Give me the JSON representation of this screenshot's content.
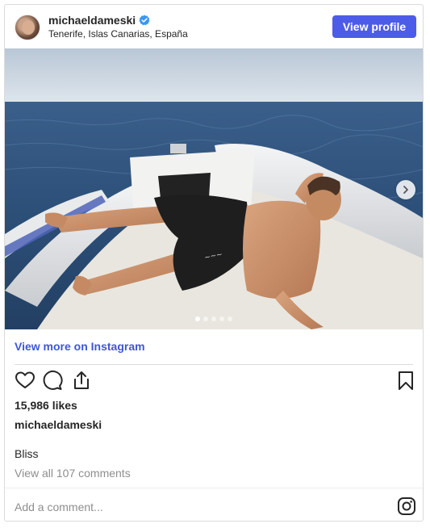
{
  "header": {
    "username": "michaeldameski",
    "verified_icon": "verified-badge-icon",
    "location": "Tenerife, Islas Canarias, España",
    "view_profile_label": "View profile"
  },
  "media": {
    "slide_count": 5,
    "active_slide": 1,
    "next_icon": "chevron-right-icon"
  },
  "links": {
    "view_more": "View more on Instagram"
  },
  "actions": {
    "icons": [
      "heart-icon",
      "comment-icon",
      "share-icon",
      "bookmark-icon"
    ]
  },
  "post": {
    "likes": "15,986 likes",
    "caption_user": "michaeldameski",
    "caption": "Bliss",
    "view_comments": "View all 107 comments"
  },
  "comment": {
    "placeholder": "Add a comment..."
  },
  "colors": {
    "accent": "#4c5ce8",
    "link": "#3f56d9",
    "verified": "#3897f0",
    "muted": "#8e8e8e"
  }
}
